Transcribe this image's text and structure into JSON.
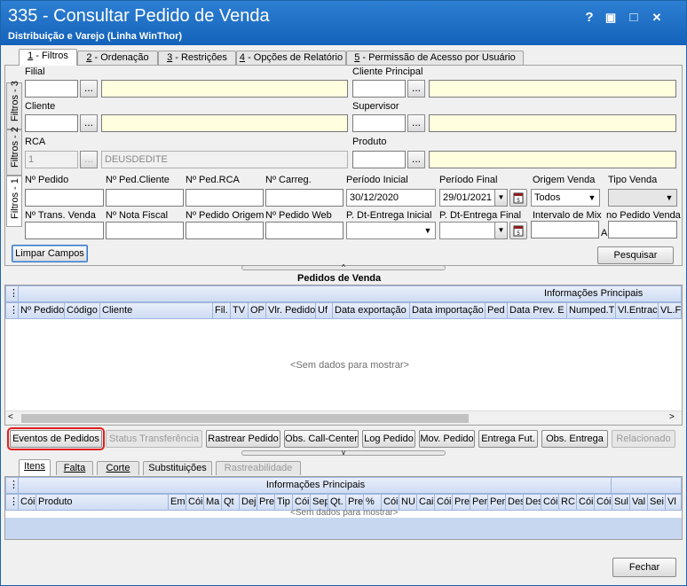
{
  "window": {
    "title": "335 - Consultar Pedido de Venda",
    "subtitle": "Distribuição e Varejo (Linha WinThor)",
    "help": "?",
    "restore": "▣",
    "maximize": "□",
    "close": "✕"
  },
  "tabs": [
    {
      "num": "1",
      "label": " - Filtros"
    },
    {
      "num": "2",
      "label": " - Ordenação"
    },
    {
      "num": "3",
      "label": " - Restrições"
    },
    {
      "num": "4",
      "label": " - Opções de Relatório"
    },
    {
      "num": "5",
      "label": " - Permissão de Acesso por Usuário"
    }
  ],
  "side_tabs": [
    "Filtros - 3",
    "Filtros - 2",
    "Filtros - 1"
  ],
  "filters": {
    "filial": "Filial",
    "cliente_principal": "Cliente Principal",
    "cliente": "Cliente",
    "supervisor": "Supervisor",
    "rca": "RCA",
    "rca_code": "1",
    "rca_name": "DEUSDEDITE",
    "produto": "Produto",
    "dots": "...",
    "num_pedido": "Nº Pedido",
    "num_ped_cliente": "Nº Ped.Cliente",
    "num_ped_rca": "Nº Ped.RCA",
    "num_carreg": "Nº Carreg.",
    "periodo_inicial": "Período Inicial",
    "periodo_inicial_value": "30/12/2020",
    "periodo_final": "Período Final",
    "periodo_final_value": "29/01/2021",
    "origem_venda": "Origem Venda",
    "origem_venda_value": "Todos",
    "tipo_venda": "Tipo Venda",
    "num_trans_venda": "Nº Trans. Venda",
    "num_nota_fiscal": "Nº Nota Fiscal",
    "num_pedido_origem": "Nº Pedido Origem",
    "num_pedido_web": "Nº Pedido Web",
    "dt_entrega_inicial": "P. Dt-Entrega Inicial",
    "dt_entrega_final": "P. Dt-Entrega Final",
    "intervalo_mix": "Intervalo de Mix",
    "intervalo_sep": "A",
    "mix_pedido": "no Pedido Venda",
    "limpar": "Limpar Campos",
    "pesquisar": "Pesquisar"
  },
  "pedidos": {
    "title": "Pedidos de  Venda",
    "group": "Informações Principais",
    "columns": [
      "Nº Pedido",
      "Código",
      "Cliente",
      "Fil.",
      "TV",
      "OP",
      "Vlr. Pedido",
      "Uf",
      "Data exportação",
      "Data importação",
      "Ped",
      "Data Prev. E",
      "Numped.T",
      "Vl.Entrac",
      "VL.F"
    ],
    "empty": "<Sem dados para mostrar>"
  },
  "actions": [
    "Eventos de Pedidos",
    "Status Transferência",
    "Rastrear Pedido",
    "Obs. Call-Center",
    "Log Pedido",
    "Mov. Pedido",
    "Entrega Fut.",
    "Obs. Entrega",
    "Relacionado"
  ],
  "lower_tabs": [
    "Itens",
    "Falta",
    "Corte",
    "Substituições",
    "Rastreabilidade"
  ],
  "itens": {
    "group": "Informações Principais",
    "columns": [
      "Cói",
      "Produto",
      "Em",
      "Cói",
      "Ma",
      "Qt",
      "Dej",
      "Pre",
      "Tip",
      "Cói",
      "Sep",
      "Qt.",
      "Pre",
      "%",
      "Cói",
      "NU",
      "Cai",
      "Cói",
      "Pre",
      "Per",
      "Per",
      "Des",
      "Des",
      "Cói",
      "RC",
      "Cói",
      "Cói",
      "Sul",
      "Val",
      "Sei",
      "Vl"
    ],
    "empty": "<Sem dados para mostrar>"
  },
  "fechar": "Fechar",
  "icons": [
    "help-icon",
    "restore-icon",
    "maximize-icon",
    "close-icon",
    "calendar-icon",
    "dropdown-arrow-icon",
    "grid-menu-icon",
    "scroll-left-icon",
    "scroll-right-icon",
    "collapse-grip-icon"
  ],
  "colors": {
    "title_bar": "#1f6fc5",
    "lookup_field": "#ffffe0",
    "grid_header": "#d7e2f5",
    "grid_band": "#c7d7f0",
    "highlight": "#e0201c"
  }
}
